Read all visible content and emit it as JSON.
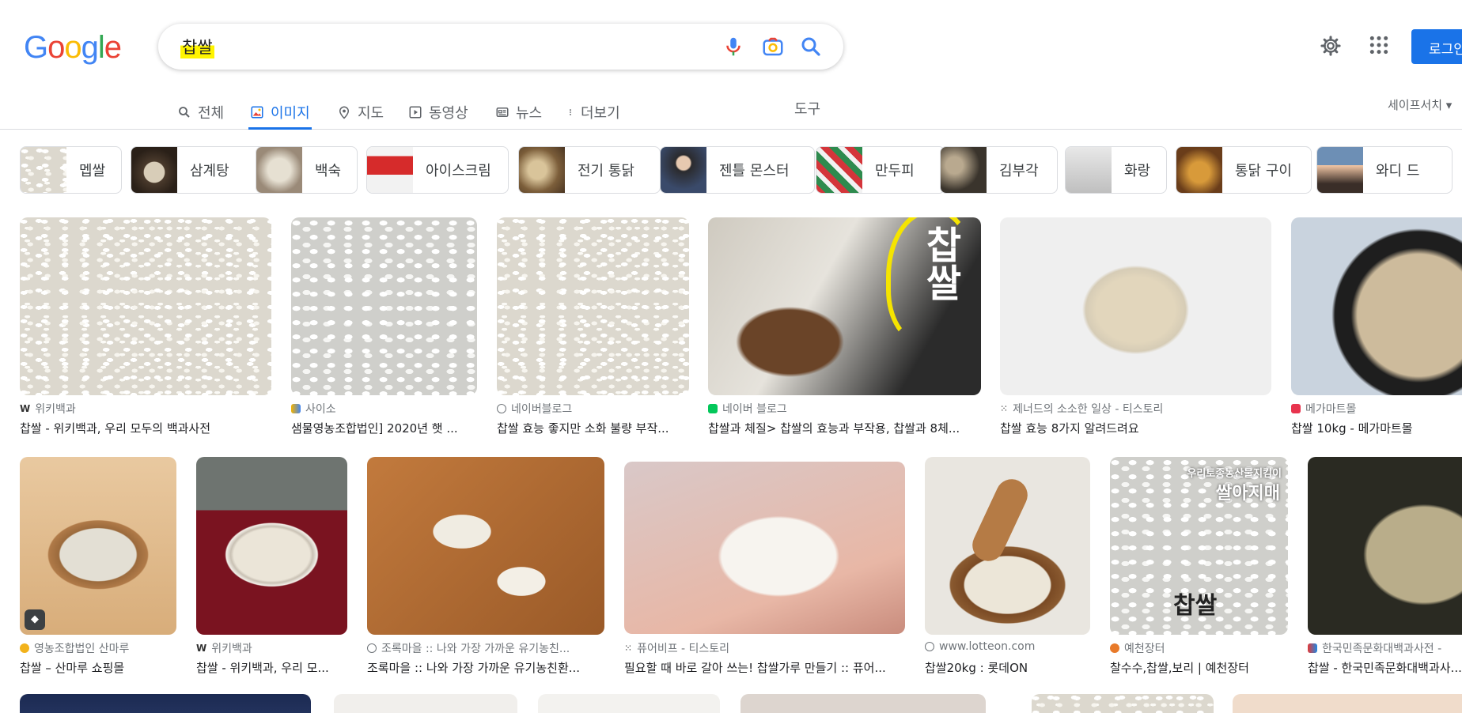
{
  "header": {
    "logo_letters": [
      {
        "ch": "G",
        "color": "#4285f4"
      },
      {
        "ch": "o",
        "color": "#ea4335"
      },
      {
        "ch": "o",
        "color": "#fbbc05"
      },
      {
        "ch": "g",
        "color": "#4285f4"
      },
      {
        "ch": "l",
        "color": "#34a853"
      },
      {
        "ch": "e",
        "color": "#ea4335"
      }
    ],
    "query": "찹쌀",
    "login_label": "로그인"
  },
  "tabs": [
    {
      "label": "전체",
      "icon": "search-icon"
    },
    {
      "label": "이미지",
      "icon": "image-icon",
      "active": true
    },
    {
      "label": "지도",
      "icon": "map-pin-icon"
    },
    {
      "label": "동영상",
      "icon": "video-icon"
    },
    {
      "label": "뉴스",
      "icon": "news-icon"
    },
    {
      "label": "더보기",
      "icon": "more-vert-icon"
    }
  ],
  "tools_label": "도구",
  "safesearch_label": "세이프서치 ▾",
  "chips": [
    "멥쌀",
    "삼계탕",
    "백숙",
    "아이스크림",
    "전기 통닭",
    "젠틀 몬스터",
    "만두피",
    "김부각",
    "화랑",
    "통닭 구이",
    "와디 드"
  ],
  "results_row1": [
    {
      "source": "위키백과",
      "title": "찹쌀 - 위키백과, 우리 모두의 백과사전"
    },
    {
      "source": "사이소",
      "title": "샘물영농조합법인] 2020년 햇 ..."
    },
    {
      "source": "네이버블로그",
      "title": "찹쌀 효능 좋지만 소화 불량 부작..."
    },
    {
      "source": "네이버 블로그",
      "title": "찹쌀과 체질> 찹쌀의 효능과 부작용, 찹쌀과 8체..."
    },
    {
      "source": "제너드의 소소한 일상 - 티스토리",
      "title": "찹쌀 효능 8가지 알려드려요"
    },
    {
      "source": "메가마트몰",
      "title": "찹쌀 10kg - 메가마트몰"
    }
  ],
  "results_row2": [
    {
      "source": "영농조합법인 산마루",
      "title": "찹쌀 – 산마루 쇼핑몰"
    },
    {
      "source": "위키백과",
      "title": "찹쌀 - 위키백과, 우리 모..."
    },
    {
      "source": "조록마을 :: 나와 가장 가까운 유기농친...",
      "title": "조록마을 :: 나와 가장 가까운 유기농친환..."
    },
    {
      "source": "퓨어비프 - 티스토리",
      "title": "필요할 때 바로 갈아 쓰는! 찹쌀가루 만들기 :: 퓨어..."
    },
    {
      "source": "www.lotteon.com",
      "title": "찹쌀20kg : 롯데ON"
    },
    {
      "source": "예천장터",
      "title": "찰수수,찹쌀,보리 | 예천장터"
    },
    {
      "source": "한국민족문화대백과사전 -",
      "title": "찹쌀 - 한국민족문화대백과사..."
    }
  ],
  "image_overlays": {
    "img4_text": "찹쌀",
    "img12_top": "우리토종농산물지킴이",
    "img12_brand": "쌀아지매",
    "img12_label": "찹쌀"
  },
  "colors": {
    "accent": "#1a73e8",
    "highlight": "#fff400"
  }
}
